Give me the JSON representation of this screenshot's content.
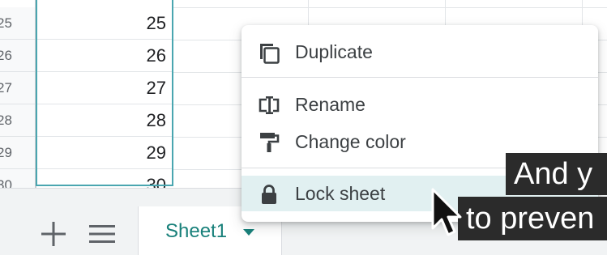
{
  "grid": {
    "rows": [
      {
        "header": "25",
        "value": "25"
      },
      {
        "header": "26",
        "value": "26"
      },
      {
        "header": "27",
        "value": "27"
      },
      {
        "header": "28",
        "value": "28"
      },
      {
        "header": "29",
        "value": "29"
      },
      {
        "header": "30",
        "value": "30"
      }
    ]
  },
  "sheetbar": {
    "add_sheet_icon": "plus-icon",
    "all_sheets_icon": "menu-icon",
    "active_tab": "Sheet1",
    "tab_menu_icon": "caret-down-icon",
    "accent_color": "#18807a"
  },
  "context_menu": {
    "items": [
      {
        "label": "Duplicate",
        "icon": "duplicate-icon"
      },
      {
        "label": "Rename",
        "icon": "rename-icon"
      },
      {
        "label": "Change color",
        "icon": "paint-roller-icon"
      },
      {
        "label": "Lock sheet",
        "icon": "lock-icon",
        "highlighted": true
      }
    ]
  },
  "caption": {
    "line1": "And y",
    "line2": "to preven"
  }
}
